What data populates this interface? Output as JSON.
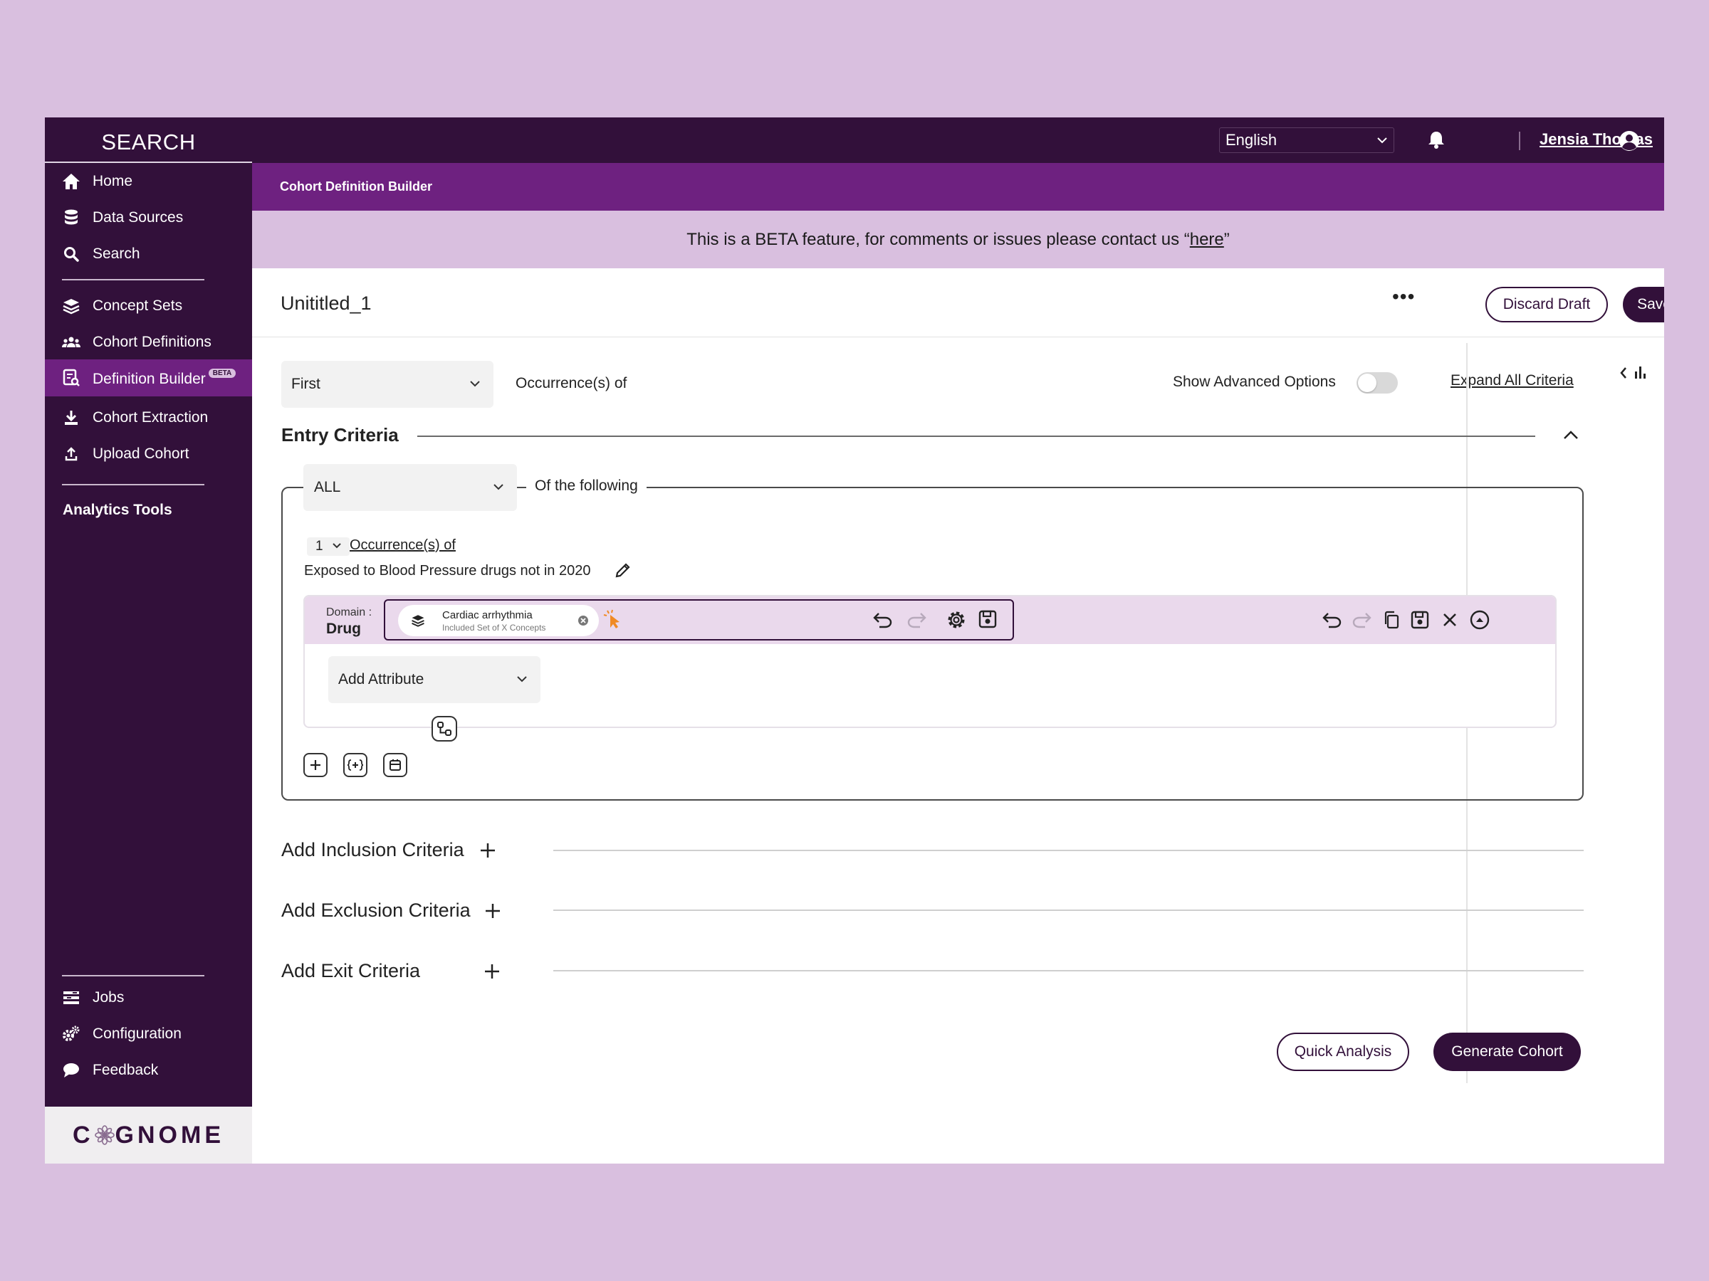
{
  "sidebar": {
    "brand": "SEARCH",
    "items": [
      {
        "label": "Home",
        "icon": "home-icon"
      },
      {
        "label": "Data Sources",
        "icon": "database-icon"
      },
      {
        "label": "Search",
        "icon": "search-icon"
      },
      {
        "label": "Concept Sets",
        "icon": "layers-icon"
      },
      {
        "label": "Cohort Definitions",
        "icon": "users-icon"
      },
      {
        "label": "Definition Builder",
        "icon": "builder-icon",
        "badge": "BETA",
        "active": true
      },
      {
        "label": "Cohort Extraction",
        "icon": "download-icon"
      },
      {
        "label": "Upload Cohort",
        "icon": "upload-icon"
      }
    ],
    "section_title": "Analytics Tools",
    "bottom_items": [
      {
        "label": "Jobs",
        "icon": "jobs-icon"
      },
      {
        "label": "Configuration",
        "icon": "gears-icon"
      },
      {
        "label": "Feedback",
        "icon": "chat-icon"
      }
    ],
    "logo_text_left": "C",
    "logo_text_right": "GNOME"
  },
  "topbar": {
    "language": "English",
    "user_name": "Jensia Thomas"
  },
  "subheader": {
    "title": "Cohort Definition Builder"
  },
  "banner": {
    "text_before": "This is a BETA feature, for comments or issues please contact us “",
    "link": "here",
    "text_after": "”"
  },
  "title_row": {
    "title": "Unititled_1",
    "more": "•••",
    "discard_label": "Discard Draft",
    "save_label": "Save"
  },
  "main": {
    "first_select": "First",
    "occurrences_of": "Occurrence(s) of",
    "advanced_label": "Show Advanced Options",
    "expand_all": "Expand All Criteria",
    "entry_title": "Entry Criteria",
    "all_select": "ALL",
    "of_following": "Of the following",
    "occ_count": "1",
    "occ_link": "Occurrence(s) of",
    "criterion_name": "Exposed to Blood Pressure drugs not in 2020",
    "domain_label": "Domain :",
    "domain_value": "Drug",
    "concept_title": "Cardiac arrhythmia",
    "concept_subtitle": "Included Set of X Concepts",
    "add_attribute": "Add Attribute",
    "add_inclusion": "Add Inclusion Criteria",
    "add_exclusion": "Add Exclusion Criteria",
    "add_exit": "Add Exit Criteria",
    "quick_analysis": "Quick Analysis",
    "generate_cohort": "Generate Cohort"
  },
  "colors": {
    "brand_dark": "#32103a",
    "brand_purple": "#6e2180",
    "banner_lilac": "#d9bfdf",
    "concept_bg": "#ead9ec"
  }
}
